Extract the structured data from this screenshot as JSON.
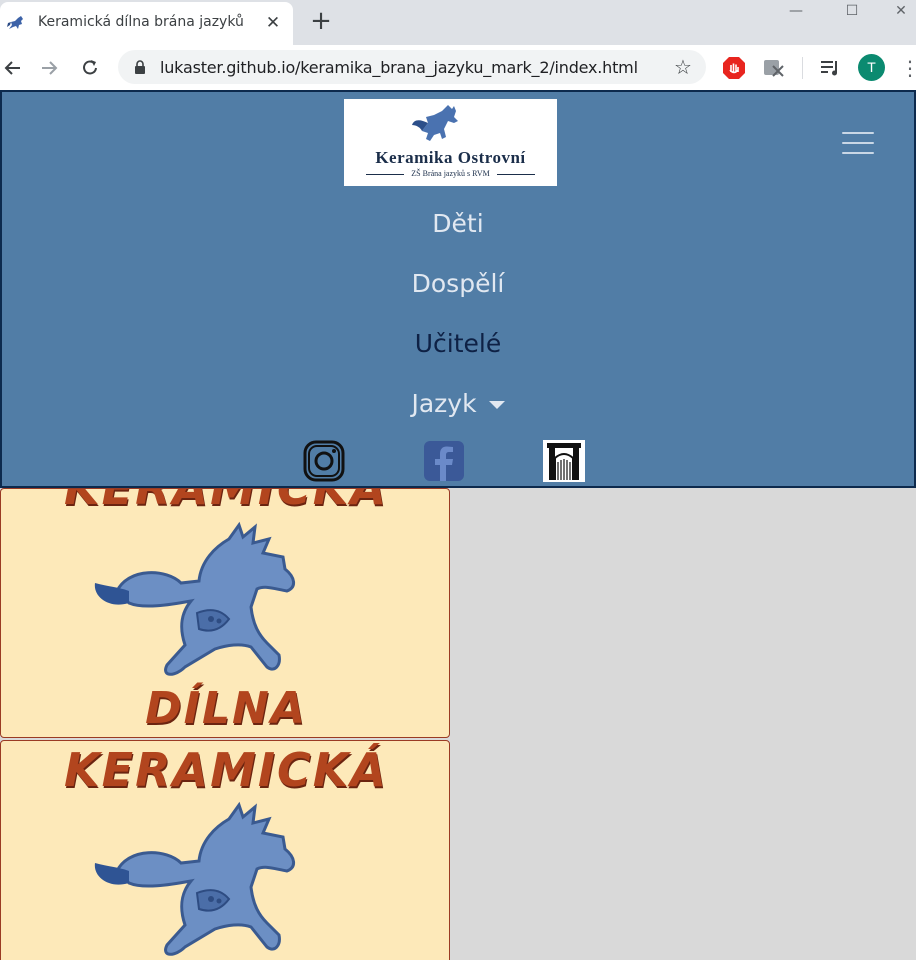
{
  "browser": {
    "tab_title": "Keramická dílna brána jazyků",
    "tab_close": "✕",
    "new_tab": "+",
    "window_controls": {
      "minimize": "—",
      "maximize": "☐",
      "close": "✕"
    },
    "url": "lukaster.github.io/keramika_brana_jazyku_mark_2/index.html",
    "profile_initial": "T",
    "icons": [
      "back-icon",
      "forward-icon",
      "reload-icon",
      "lock-icon",
      "star-icon",
      "adblock-icon",
      "extension-icon",
      "media-icon",
      "menu-icon"
    ]
  },
  "navbar": {
    "brand": {
      "title": "Keramika Ostrovní",
      "subtitle": "ZŠ Brána jazyků s RVM"
    },
    "links": [
      {
        "label": "Děti",
        "active": false
      },
      {
        "label": "Dospělí",
        "active": false
      },
      {
        "label": "Učitelé",
        "active": true
      },
      {
        "label": "Jazyk",
        "active": false,
        "dropdown": true
      }
    ],
    "social": [
      "instagram-icon",
      "facebook-icon",
      "school-gate-icon"
    ],
    "colors": {
      "background": "#517da6",
      "border": "#0d2a4d",
      "link": "#e1e8f1",
      "active_link": "#0e2145"
    }
  },
  "cards": [
    {
      "top_word": "KERAMICKÁ",
      "bottom_word": "DÍLNA"
    },
    {
      "top_word": "KERAMICKÁ"
    }
  ],
  "colors": {
    "card_bg": "#fde9b9",
    "card_text": "#b2451e",
    "page_bg": "#d9d9d9"
  }
}
